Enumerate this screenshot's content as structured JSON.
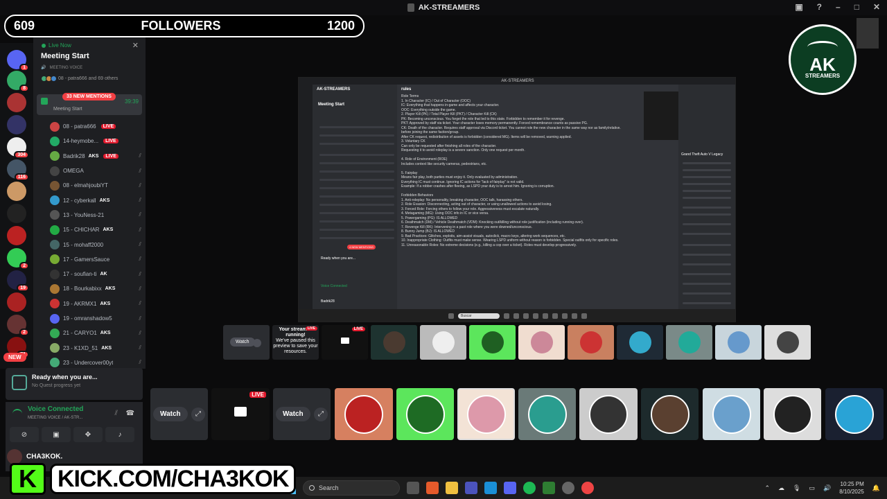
{
  "window": {
    "title": "AK-STREAMERS"
  },
  "followers_bar": {
    "current": "609",
    "label": "FOLLOWERS",
    "goal": "1200"
  },
  "servers": {
    "new_badge": "NEW",
    "badges": [
      "1",
      "8",
      "304",
      "116",
      "2",
      "19",
      "2",
      "71"
    ]
  },
  "channel": {
    "live_now": "Live Now",
    "title": "Meeting Start",
    "subtitle": "MEETING VOICE",
    "people": "08 - patra666 and 69 others",
    "mention_badge": "33 NEW MENTIONS",
    "active_label": "Meeting Start",
    "timer": "39:39"
  },
  "users": [
    {
      "name": "08 - patra666",
      "tag": "LIVE"
    },
    {
      "name": "14-heymobe...",
      "tag": "LIVE"
    },
    {
      "name": "Badrik28",
      "tag": "AKS",
      "live": "LIVE"
    },
    {
      "name": "OMEGA",
      "tag": ""
    },
    {
      "name": "08 - elmahjoubiYT",
      "tag": ""
    },
    {
      "name": "12 - cyberkall",
      "tag": "AKS"
    },
    {
      "name": "13 - YouNess-21",
      "tag": ""
    },
    {
      "name": "15 - CHICHAR",
      "tag": "AKS"
    },
    {
      "name": "15 - mohaff2000",
      "tag": ""
    },
    {
      "name": "17 - GamersSauce",
      "tag": ""
    },
    {
      "name": "17 - soufian-ti",
      "tag": "AK"
    },
    {
      "name": "18 - Bourkabixx",
      "tag": "AKS"
    },
    {
      "name": "19 - AKRMX1",
      "tag": "AKS"
    },
    {
      "name": "19 - omranshadow5",
      "tag": ""
    },
    {
      "name": "21 - CARYO1",
      "tag": "AKS"
    },
    {
      "name": "23 - K1XD_51",
      "tag": "AKS"
    },
    {
      "name": "23 - Undercover00yt",
      "tag": ""
    }
  ],
  "ready": {
    "title": "Ready when you are...",
    "sub": "No Quest progress yet"
  },
  "voice": {
    "status": "Voice Connected",
    "channel": "MEETING VOICE / AK-STR..."
  },
  "user_panel": {
    "name": "CHA3KOK."
  },
  "kick": {
    "letter": "K",
    "url": "KICK.COM/CHA3KOK"
  },
  "logo": {
    "main": "AK",
    "sub": "STREAMERS"
  },
  "screenshare": {
    "titlebar": "AK-STREAMERS",
    "server_name": "AK-STREAMERS",
    "meeting": "Meeting Start",
    "mentions": "4 NEW MENTIONS",
    "ready": "Ready when you are...",
    "voice": "Voice Connected",
    "user": "Badrik28",
    "channel_header": "rules",
    "game_title": "Grand Theft Auto V Legacy",
    "search": "Buscar",
    "rules_lines": [
      "Role Terms",
      "1. In Character (IC) / Out of Character (OOC)",
      "IC: Everything that happens in-game and affects your character.",
      "OOC: Everything outside the game.",
      "2. Player Kill (PK) / Total Player Kill (PKT) / Character Kill (CK)",
      "PK: Becoming unconscious. You forget the role that led to this state. Forbidden to remember it for revenge.",
      "PKT: Approved by staff via ticket. Your character loses memory permanently. Forced remembrance counts as passive PG.",
      "CK: Death of the character. Requires staff approval via Discord ticket. You cannot role the new character in the same way nor as family/relative.",
      "before joining the same faction/group.",
      "After CK request, redistribution of assets is forbidden (considered MG). Items will be removed, warning applied.",
      "3. Voluntary CK",
      "Can only be requested after finishing all roles of the character.",
      "Requesting it to avoid roleplay is a severe sanction. Only one request per month.",
      "",
      "4. Role of Environment (ROE)",
      "Includes context like security cameras, pedestrians, etc.",
      "",
      "5. Fairplay",
      "Means fair play, both parties must enjoy it. Only evaluated by administration.",
      "Everything IC must continue. Ignoring IC actions for \"lack of fairplay\" is not valid.",
      "Example: If a robber crashes after fleeing, as LSPD your duty is to arrest him. Ignoring is corruption.",
      "",
      "Forbidden Behaviors",
      "1. Anti-roleplay: No personality, breaking character, OOC talk, harassing others.",
      "2. Role Evasion: Disconnecting, acting out of character, or using unallowed actions to avoid losing.",
      "3. Forced Role: Forcing others to follow your role. Aggressiveness must escalate naturally.",
      "4. Metagaming (MG): Using OOC info in IC or vice versa.",
      "5. Powergaming (PG): IS ALLOWED",
      "6. Deathmatch (DM) / Vehicle Deathmatch (VDM): Knocking out/killing without role justification (including running over).",
      "7. Revenge Kill (RK): Intervening in a past role where you were downed/unconscious.",
      "8. Bunny Jump (BJ): IS ALLOWED",
      "9. Bad Practices: Glitches, exploits, aim-assist visuals, autoclick, macro keys, altering work sequences, etc.",
      "10. Inappropriate Clothing: Outfits must make sense. Wearing LSPD uniform without reason is forbidden. Special outfits only for specific roles.",
      "11. Unreasonable Roles: No extreme decisions (e.g., killing a cop over a ticket). Roles must develop progressively."
    ]
  },
  "mini_strip": {
    "watch": "Watch",
    "live": "LIVE",
    "stream_msg": [
      "Your stream is",
      "running!",
      "We've paused this",
      "preview to save your",
      "resources."
    ]
  },
  "tiles": {
    "watch": "Watch",
    "live": "LIVE"
  },
  "taskbar": {
    "search": "Search",
    "time": "10:25 PM",
    "date": "8/10/2025"
  }
}
